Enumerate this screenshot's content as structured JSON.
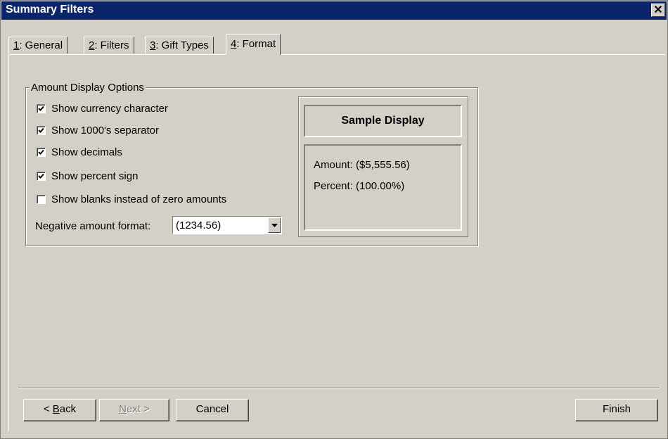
{
  "window": {
    "title": "Summary Filters",
    "close_glyph": "✕"
  },
  "tabs": [
    {
      "key": "1",
      "label": ": General"
    },
    {
      "key": "2",
      "label": ": Filters"
    },
    {
      "key": "3",
      "label": ": Gift Types"
    },
    {
      "key": "4",
      "label": ": Format",
      "active": true
    }
  ],
  "amount_options": {
    "group_label": "Amount Display Options",
    "checkboxes": [
      {
        "label": "Show currency character",
        "checked": true
      },
      {
        "label": "Show 1000's separator",
        "checked": true
      },
      {
        "label": "Show decimals",
        "checked": true
      },
      {
        "label": "Show percent sign",
        "checked": true
      },
      {
        "label": "Show blanks instead of zero amounts",
        "checked": false
      }
    ],
    "negative_format_label": "Negative amount format:",
    "negative_format_value": "(1234.56)"
  },
  "sample": {
    "title": "Sample Display",
    "amount_line": "Amount:  ($5,555.56)",
    "percent_line": "Percent:  (100.00%)"
  },
  "buttons": {
    "back_prefix": "< ",
    "back_key": "B",
    "back_rest": "ack",
    "next_key": "N",
    "next_rest": "ext >",
    "cancel": "Cancel",
    "finish": "Finish"
  }
}
